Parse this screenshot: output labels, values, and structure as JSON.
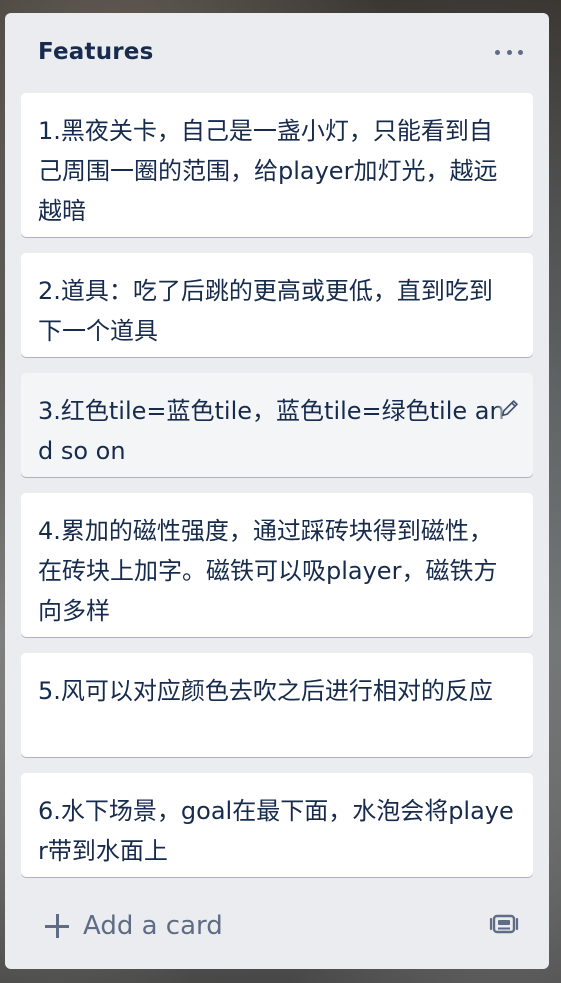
{
  "list": {
    "title": "Features",
    "more_icon": "more-horizontal-icon",
    "cards": [
      "1.黑夜关卡，自己是一盏小灯，只能看到自己周围一圈的范围，给player加灯光，越远越暗",
      "2.道具：吃了后跳的更高或更低，直到吃到下一个道具",
      "3.红色tile=蓝色tile，蓝色tile=绿色tile and so on",
      "4.累加的磁性强度，通过踩砖块得到磁性，在砖块上加字。磁铁可以吸player，磁铁方向多样",
      "5.风可以对应颜色去吹之后进行相对的反应",
      "6.水下场景，goal在最下面，水泡会将player带到水面上"
    ],
    "add_card_label": "Add a card",
    "add_icon": "plus-icon",
    "template_icon": "card-template-icon",
    "edit_icon": "pencil-icon"
  },
  "colors": {
    "list_bg": "#ebecf0",
    "card_bg": "#ffffff",
    "text": "#172b4d",
    "muted": "#5e6c84"
  }
}
